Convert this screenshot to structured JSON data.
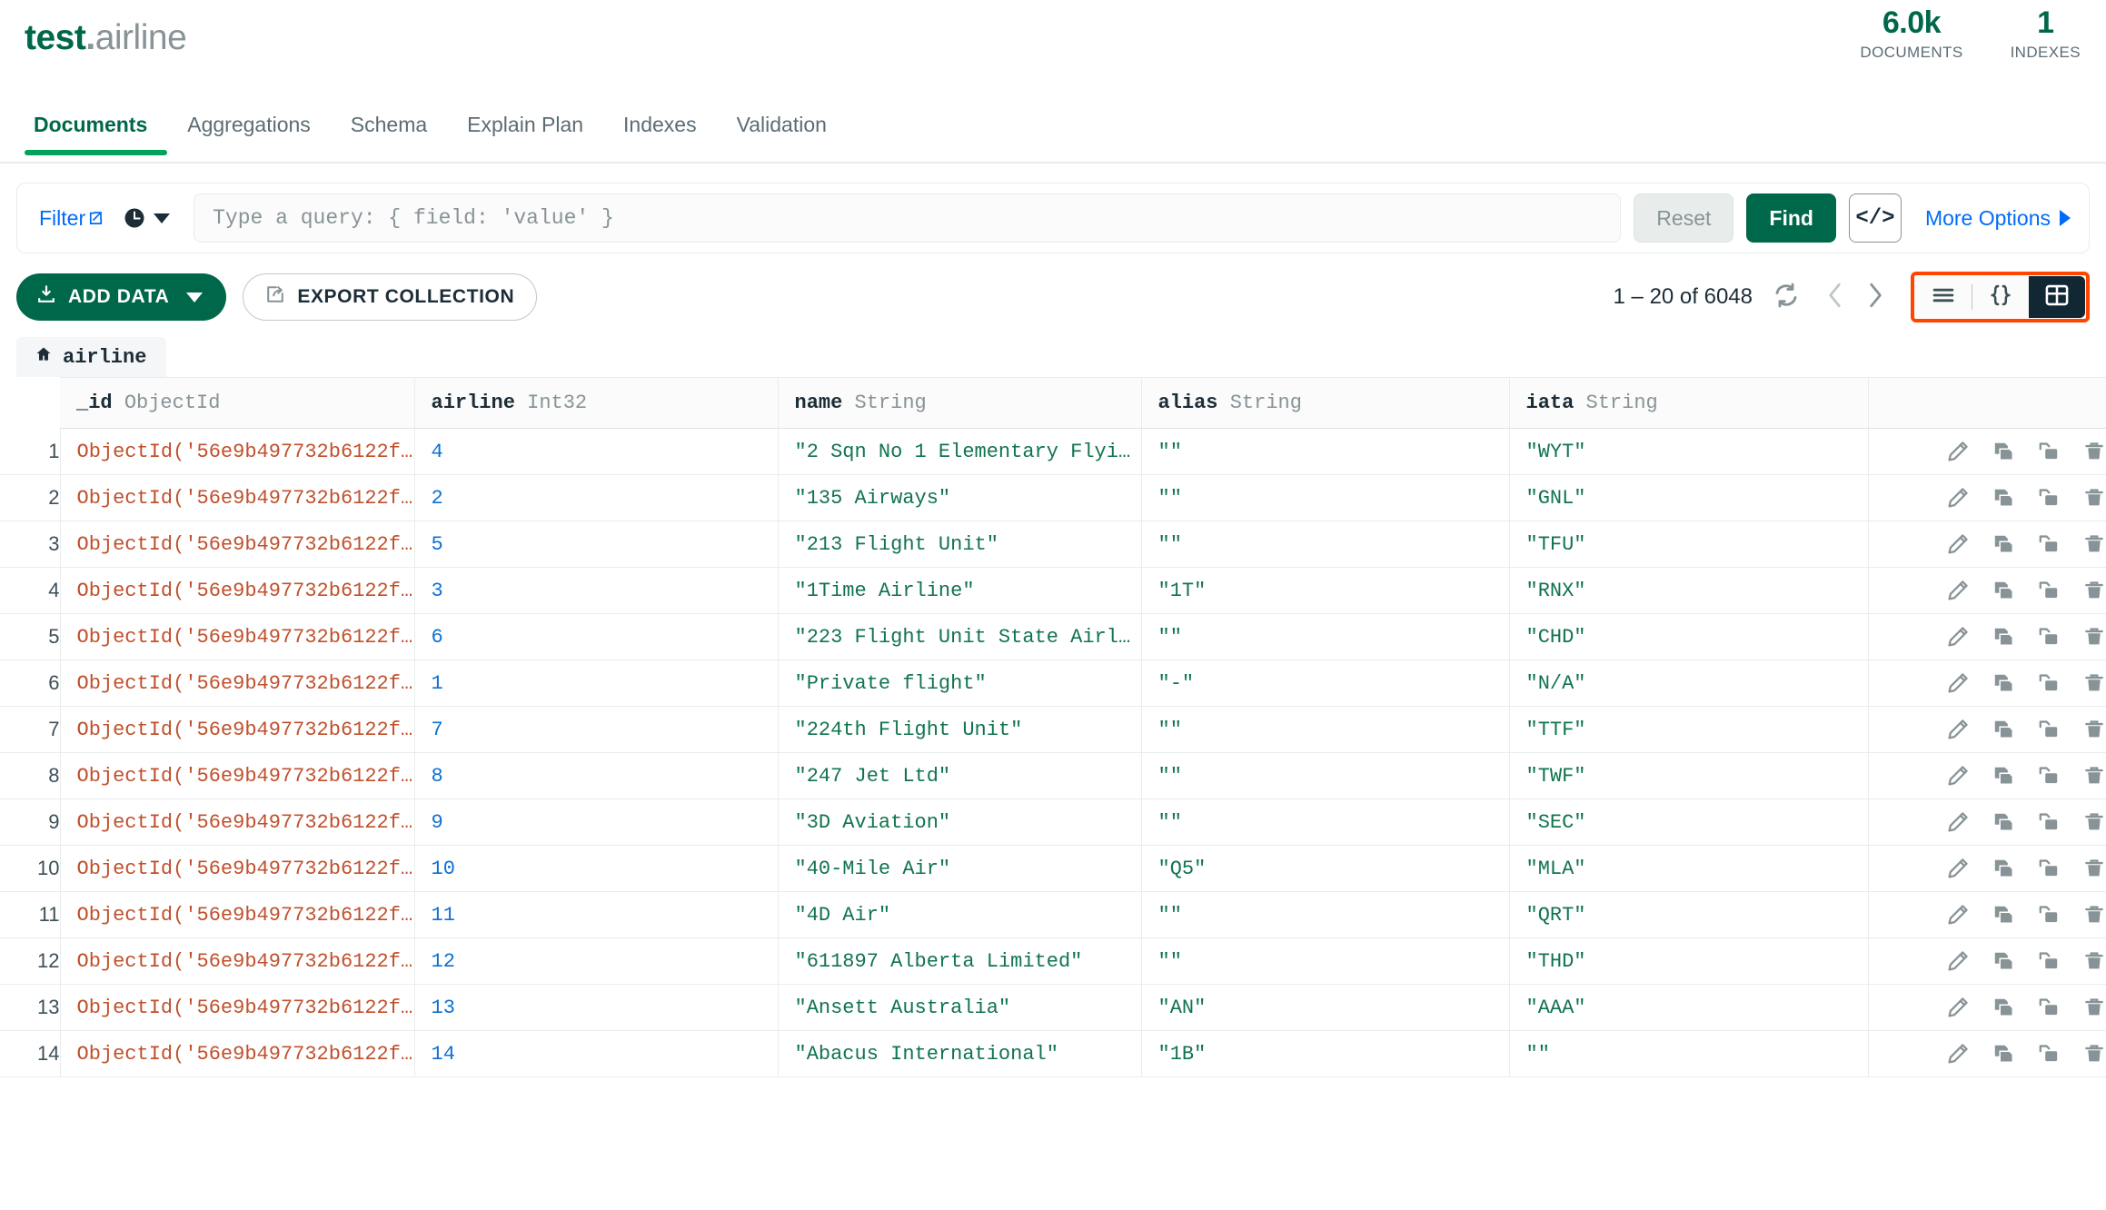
{
  "header": {
    "db_name": "test",
    "separator": ".",
    "collection_name": "airline",
    "stats": [
      {
        "value": "6.0k",
        "label": "DOCUMENTS"
      },
      {
        "value": "1",
        "label": "INDEXES"
      }
    ]
  },
  "tabs": [
    {
      "label": "Documents",
      "active": true
    },
    {
      "label": "Aggregations",
      "active": false
    },
    {
      "label": "Schema",
      "active": false
    },
    {
      "label": "Explain Plan",
      "active": false
    },
    {
      "label": "Indexes",
      "active": false
    },
    {
      "label": "Validation",
      "active": false
    }
  ],
  "query_bar": {
    "filter_label": "Filter",
    "query_value": "",
    "query_placeholder": "Type a query: { field: 'value' }",
    "reset_label": "Reset",
    "find_label": "Find",
    "code_label": "</>",
    "more_options_label": "More Options"
  },
  "toolbar": {
    "add_data_label": "ADD DATA",
    "export_label": "EXPORT COLLECTION",
    "pagination": "1 – 20 of 6048",
    "view_modes": [
      {
        "name": "list-view",
        "selected": false
      },
      {
        "name": "json-view",
        "selected": false
      },
      {
        "name": "table-view",
        "selected": true
      }
    ]
  },
  "table": {
    "breadcrumb": "airline",
    "columns": [
      {
        "field": "_id",
        "type": "ObjectId"
      },
      {
        "field": "airline",
        "type": "Int32"
      },
      {
        "field": "name",
        "type": "String"
      },
      {
        "field": "alias",
        "type": "String"
      },
      {
        "field": "iata",
        "type": "String"
      }
    ],
    "rows": [
      {
        "n": "1",
        "_id": "ObjectId('56e9b497732b6122f…",
        "airline": "4",
        "name": "\"2 Sqn No 1 Elementary Flyi…",
        "alias": "\"\"",
        "iata": "\"WYT\""
      },
      {
        "n": "2",
        "_id": "ObjectId('56e9b497732b6122f…",
        "airline": "2",
        "name": "\"135 Airways\"",
        "alias": "\"\"",
        "iata": "\"GNL\""
      },
      {
        "n": "3",
        "_id": "ObjectId('56e9b497732b6122f…",
        "airline": "5",
        "name": "\"213 Flight Unit\"",
        "alias": "\"\"",
        "iata": "\"TFU\""
      },
      {
        "n": "4",
        "_id": "ObjectId('56e9b497732b6122f…",
        "airline": "3",
        "name": "\"1Time Airline\"",
        "alias": "\"1T\"",
        "iata": "\"RNX\""
      },
      {
        "n": "5",
        "_id": "ObjectId('56e9b497732b6122f…",
        "airline": "6",
        "name": "\"223 Flight Unit State Airl…",
        "alias": "\"\"",
        "iata": "\"CHD\""
      },
      {
        "n": "6",
        "_id": "ObjectId('56e9b497732b6122f…",
        "airline": "1",
        "name": "\"Private flight\"",
        "alias": "\"-\"",
        "iata": "\"N/A\""
      },
      {
        "n": "7",
        "_id": "ObjectId('56e9b497732b6122f…",
        "airline": "7",
        "name": "\"224th Flight Unit\"",
        "alias": "\"\"",
        "iata": "\"TTF\""
      },
      {
        "n": "8",
        "_id": "ObjectId('56e9b497732b6122f…",
        "airline": "8",
        "name": "\"247 Jet Ltd\"",
        "alias": "\"\"",
        "iata": "\"TWF\""
      },
      {
        "n": "9",
        "_id": "ObjectId('56e9b497732b6122f…",
        "airline": "9",
        "name": "\"3D Aviation\"",
        "alias": "\"\"",
        "iata": "\"SEC\""
      },
      {
        "n": "10",
        "_id": "ObjectId('56e9b497732b6122f…",
        "airline": "10",
        "name": "\"40-Mile Air\"",
        "alias": "\"Q5\"",
        "iata": "\"MLA\""
      },
      {
        "n": "11",
        "_id": "ObjectId('56e9b497732b6122f…",
        "airline": "11",
        "name": "\"4D Air\"",
        "alias": "\"\"",
        "iata": "\"QRT\""
      },
      {
        "n": "12",
        "_id": "ObjectId('56e9b497732b6122f…",
        "airline": "12",
        "name": "\"611897 Alberta Limited\"",
        "alias": "\"\"",
        "iata": "\"THD\""
      },
      {
        "n": "13",
        "_id": "ObjectId('56e9b497732b6122f…",
        "airline": "13",
        "name": "\"Ansett Australia\"",
        "alias": "\"AN\"",
        "iata": "\"AAA\""
      },
      {
        "n": "14",
        "_id": "ObjectId('56e9b497732b6122f…",
        "airline": "14",
        "name": "\"Abacus International\"",
        "alias": "\"1B\"",
        "iata": "\"\""
      }
    ],
    "row_actions": [
      "edit-icon",
      "clone-icon",
      "copy-icon",
      "delete-icon"
    ]
  },
  "colors": {
    "brand_green": "#00684A",
    "accent_green": "#00A35C",
    "link_blue": "#016BF8",
    "objectid_red": "#C0502C",
    "int_blue": "#0E6FD4",
    "string_green": "#11744E",
    "highlight_orange": "#FF4500"
  }
}
